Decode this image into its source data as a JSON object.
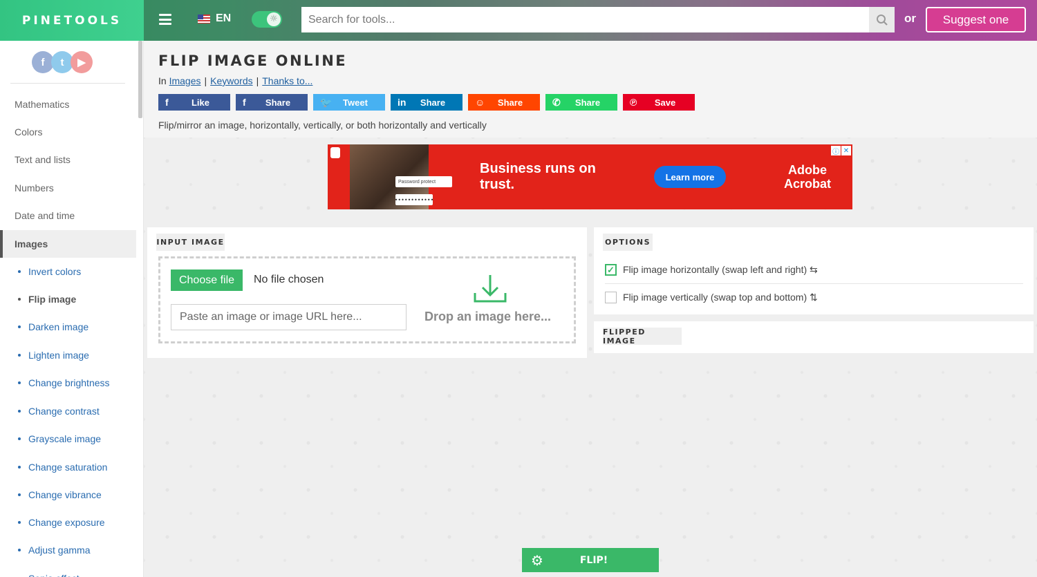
{
  "header": {
    "logo": "PINETOOLS",
    "lang": "EN",
    "search_placeholder": "Search for tools...",
    "or": "or",
    "suggest": "Suggest one"
  },
  "sidebar": {
    "socials": [
      "f",
      "t",
      "▶"
    ],
    "categories": [
      "Mathematics",
      "Colors",
      "Text and lists",
      "Numbers",
      "Date and time",
      "Images"
    ],
    "tools": [
      "Invert colors",
      "Flip image",
      "Darken image",
      "Lighten image",
      "Change brightness",
      "Change contrast",
      "Grayscale image",
      "Change saturation",
      "Change vibrance",
      "Change exposure",
      "Adjust gamma",
      "Sepia effect"
    ]
  },
  "page": {
    "title": "FLIP IMAGE ONLINE",
    "breadcrumb_in": "In",
    "links": [
      "Images",
      "Keywords",
      "Thanks to..."
    ],
    "shares": [
      {
        "icon": "f",
        "label": "Like"
      },
      {
        "icon": "f",
        "label": "Share"
      },
      {
        "icon": "🐦",
        "label": "Tweet"
      },
      {
        "icon": "in",
        "label": "Share"
      },
      {
        "icon": "☺",
        "label": "Share"
      },
      {
        "icon": "✆",
        "label": "Share"
      },
      {
        "icon": "℗",
        "label": "Save"
      }
    ],
    "description": "Flip/mirror an image, horizontally, vertically, or both horizontally and vertically"
  },
  "ad": {
    "password_label": "Password protect",
    "dots": "••••••••••••",
    "headline": "Business runs on trust.",
    "cta": "Learn more",
    "brand_line1": "Adobe",
    "brand_line2": "Acrobat"
  },
  "input": {
    "label": "INPUT IMAGE",
    "choose": "Choose file",
    "no_file": "No file chosen",
    "url_placeholder": "Paste an image or image URL here...",
    "drop": "Drop an image here..."
  },
  "options": {
    "label": "OPTIONS",
    "items": [
      {
        "label": "Flip image horizontally (swap left and right) ⇆",
        "checked": true
      },
      {
        "label": "Flip image vertically (swap top and bottom) ⇅",
        "checked": false
      }
    ]
  },
  "output": {
    "label": "FLIPPED IMAGE"
  },
  "action": {
    "flip": "FLIP!"
  },
  "colors": {
    "accent": "#3ab868",
    "suggest": "#d63d92",
    "link": "#1f5f9f",
    "ad_red": "#e2231a"
  }
}
